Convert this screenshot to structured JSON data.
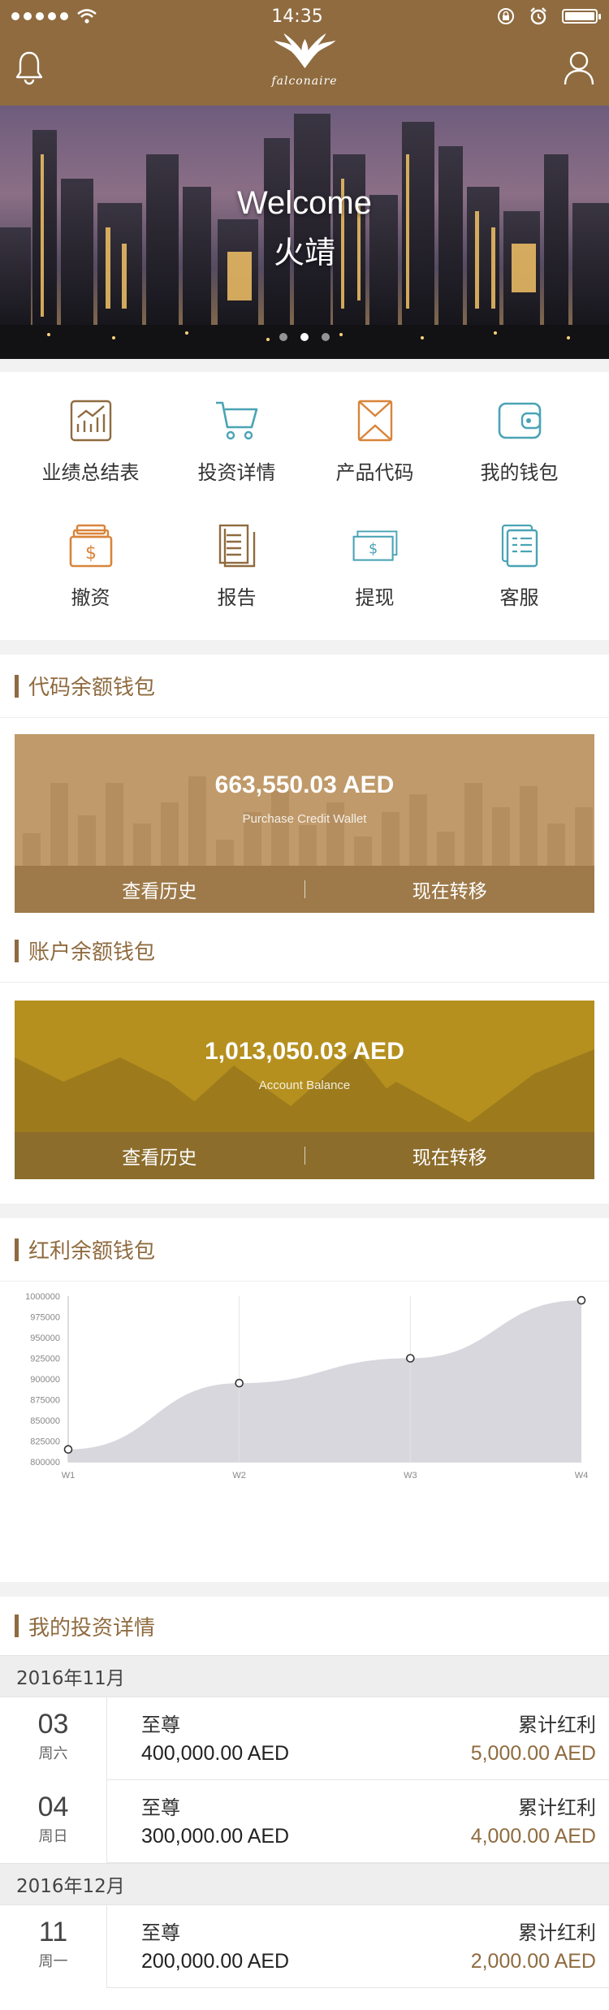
{
  "status_bar": {
    "time": "14:35"
  },
  "header": {
    "logo_text": "falconaire"
  },
  "banner": {
    "welcome": "Welcome",
    "name": "火靖",
    "pages": 3,
    "active_page": 2
  },
  "menu": [
    {
      "label": "业绩总结表",
      "icon": "chart-growth-icon",
      "color": "#8f6b3f"
    },
    {
      "label": "投资详情",
      "icon": "cart-icon",
      "color": "#4aa3b5"
    },
    {
      "label": "产品代码",
      "icon": "envelope-icon",
      "color": "#d9843a"
    },
    {
      "label": "我的钱包",
      "icon": "wallet-icon",
      "color": "#4aa3b5"
    },
    {
      "label": "撤资",
      "icon": "cash-box-icon",
      "color": "#d9843a"
    },
    {
      "label": "报告",
      "icon": "report-icon",
      "color": "#8f6b3f"
    },
    {
      "label": "提现",
      "icon": "banknote-icon",
      "color": "#4aa3b5"
    },
    {
      "label": "客服",
      "icon": "documents-icon",
      "color": "#4aa3b5"
    }
  ],
  "purchase_wallet": {
    "section_title": "代码余额钱包",
    "amount": "663,550.03 AED",
    "subtitle": "Purchase Credit Wallet",
    "history_label": "查看历史",
    "transfer_label": "现在转移",
    "color": "#c09a6a"
  },
  "account_wallet": {
    "section_title": "账户余额钱包",
    "amount": "1,013,050.03 AED",
    "subtitle": "Account Balance",
    "history_label": "查看历史",
    "transfer_label": "现在转移",
    "color": "#b5901f"
  },
  "dividend_wallet": {
    "section_title": "红利余额钱包"
  },
  "chart_data": {
    "type": "area",
    "categories": [
      "W1",
      "W2",
      "W3",
      "W4"
    ],
    "values": [
      815000,
      895000,
      925000,
      995000
    ],
    "ylim": [
      800000,
      1000000
    ],
    "yticks": [
      "1000000",
      "975000",
      "950000",
      "925000",
      "900000",
      "875000",
      "850000",
      "825000",
      "800000"
    ],
    "fill_color": "#d8d7dd",
    "grid": true
  },
  "investments": {
    "section_title": "我的投资详情",
    "months": [
      {
        "label": "2016年11月",
        "items": [
          {
            "day": "03",
            "weekday": "周六",
            "plan": "至尊",
            "amount": "400,000.00 AED",
            "dividend_label": "累计红利",
            "dividend": "5,000.00 AED"
          },
          {
            "day": "04",
            "weekday": "周日",
            "plan": "至尊",
            "amount": "300,000.00 AED",
            "dividend_label": "累计红利",
            "dividend": "4,000.00 AED"
          }
        ]
      },
      {
        "label": "2016年12月",
        "items": [
          {
            "day": "11",
            "weekday": "周一",
            "plan": "至尊",
            "amount": "200,000.00 AED",
            "dividend_label": "累计红利",
            "dividend": "2,000.00 AED"
          }
        ]
      }
    ]
  }
}
